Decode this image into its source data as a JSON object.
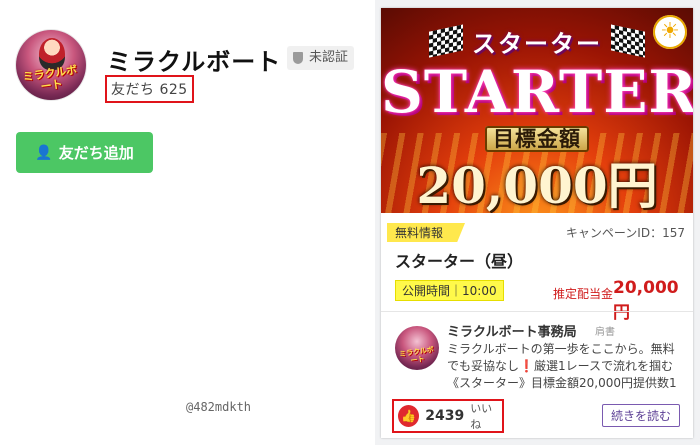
{
  "profile": {
    "name": "ミラクルボート",
    "verification": "未認証",
    "friends_label": "友だち 625",
    "avatar_logo": "ミラクルボート",
    "add_friend_label": "友だち追加",
    "handle": "@482mdkth"
  },
  "card": {
    "banner": {
      "kana": "スターター",
      "title": "STARTER",
      "target_label": "目標金額",
      "target_amount": "20,000円"
    },
    "tag": "無料情報",
    "campaign_id": "キャンペーンID：157",
    "race_title": "スターター（昼）",
    "publish_time": "公開時間｜10:00",
    "prize_label": "推定配当金",
    "prize_value": "20,000円",
    "office": {
      "name": "ミラクルボート事務局",
      "role": "肩書",
      "body": "ミラクルボートの第一歩をここから。無料でも妥協なし❗厳選1レースで流れを掴む《スターター》目標金額20,000円提供数1レース..."
    },
    "likes": {
      "count": "2439",
      "label": "いいね"
    },
    "read_more": "続きを読む"
  },
  "colors": {
    "line_green": "#4cc764",
    "highlight_red": "#e0141a",
    "prize_red": "#d01c1c"
  }
}
